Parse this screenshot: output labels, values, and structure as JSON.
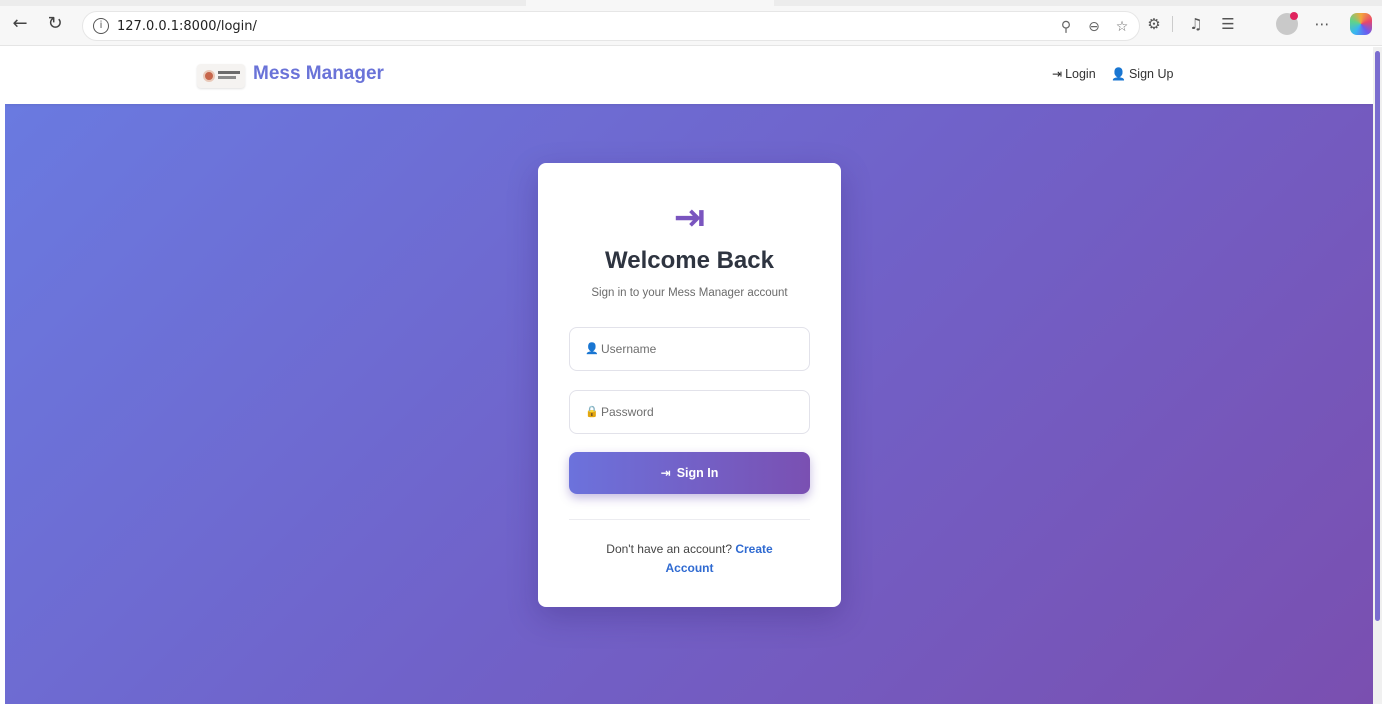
{
  "browser": {
    "url": "127.0.0.1:8000/login/"
  },
  "site": {
    "brand_name": "Mess Manager",
    "nav": {
      "login_label": "Login",
      "signup_label": "Sign Up"
    }
  },
  "login_card": {
    "title": "Welcome Back",
    "subtitle": "Sign in to your Mess Manager account",
    "username_placeholder": "Username",
    "password_placeholder": "Password",
    "submit_label": "Sign In",
    "footer_prompt": "Don't have an account? ",
    "create_account_label": "Create Account"
  },
  "colors": {
    "brand": "#6a73d8",
    "gradient_start": "#6a7ae0",
    "gradient_end": "#7a4fb0",
    "link": "#2f6ad1"
  },
  "icons": {
    "login": "sign-in-icon",
    "signup": "user-plus-icon",
    "username": "user-icon",
    "password": "lock-icon"
  }
}
